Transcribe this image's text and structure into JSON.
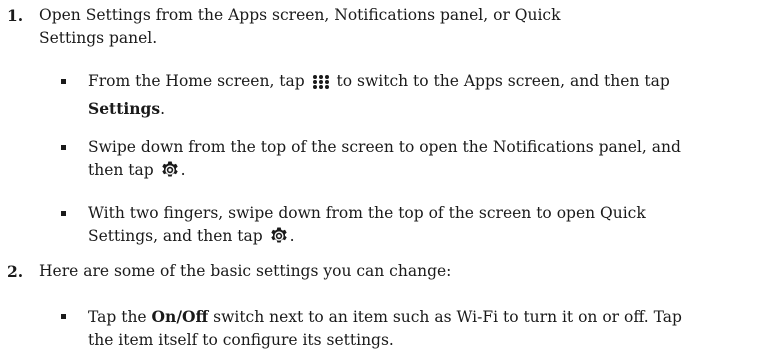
{
  "steps": [
    {
      "number": "1.",
      "text": "Open Settings from the Apps screen, Notifications panel, or Quick Settings panel.",
      "bullets": [
        {
          "before": "From the Home screen, tap ",
          "icon": "apps-grid-icon",
          "middle": " to switch to the Apps screen, and then tap ",
          "bold": "Settings",
          "after": "."
        },
        {
          "before": "Swipe down from the top of the screen to open the Notifications panel, and then tap ",
          "icon": "gear-icon",
          "after": "."
        },
        {
          "before": "With two fingers, swipe down from the top of the screen to open Quick Settings, and then tap ",
          "icon": "gear-icon",
          "after": "."
        }
      ]
    },
    {
      "number": "2.",
      "text": "Here are some of the basic settings you can change:",
      "bullets": [
        {
          "before": "Tap the ",
          "bold": "On/Off",
          "after": " switch next to an item such as Wi-Fi to turn it on or off. Tap the item itself to configure its settings."
        }
      ]
    }
  ]
}
